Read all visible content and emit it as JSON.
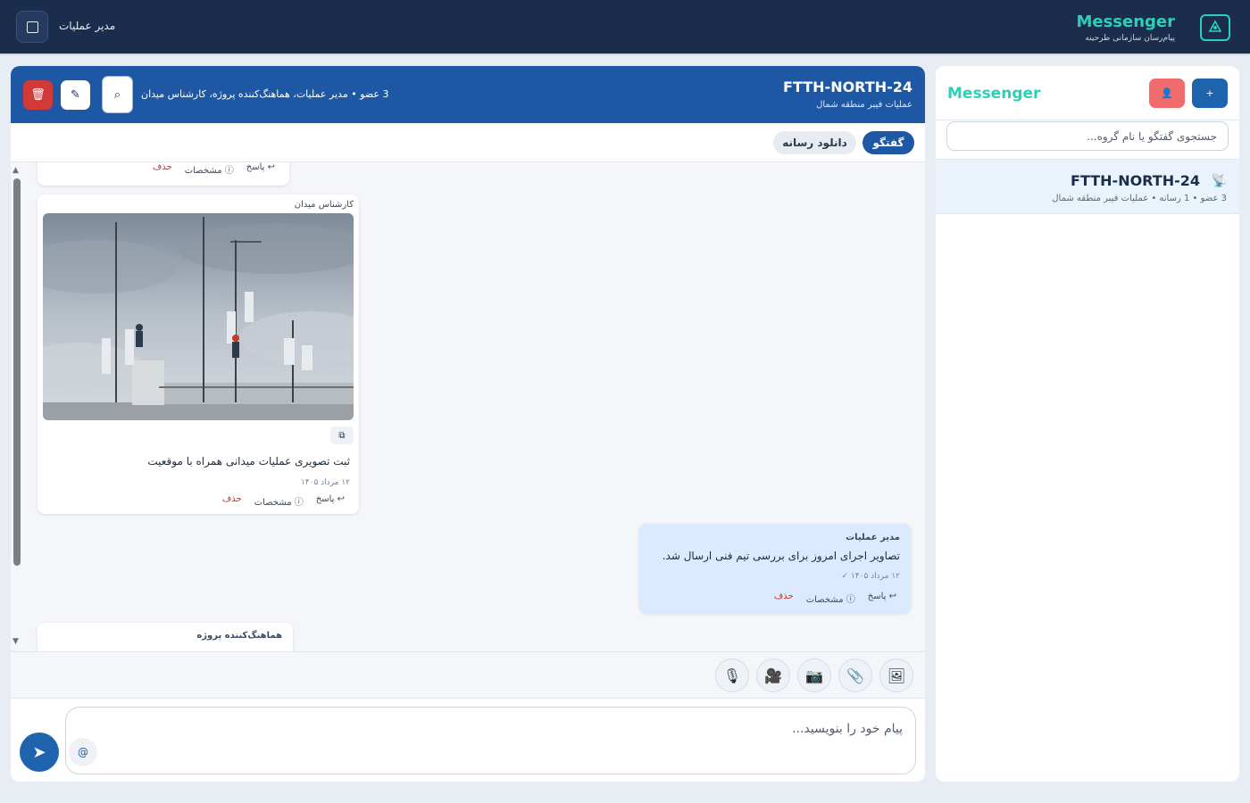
{
  "topbar": {
    "user_name": "مدیر عملیات",
    "brand_title": "Messenger",
    "brand_subtitle": "پیام‌رسان سازمانی طرحینه"
  },
  "sidebar": {
    "title": "Messenger",
    "new_button": "+",
    "search_placeholder": "جستجوی گفتگو یا نام گروه...",
    "conversations": [
      {
        "name": "FTTH-NORTH-24",
        "meta": "3 عضو • 1 رسانه • عملیات فیبر منطقه شمال"
      }
    ]
  },
  "chat": {
    "title": "FTTH-NORTH-24",
    "subtitle": "عملیات فیبر منطقه شمال",
    "members": "3 عضو • مدیر عملیات، هماهنگ‌کننده پروژه، کارشناس میدان",
    "tabs": [
      {
        "label": "گفتگو",
        "active": true
      },
      {
        "label": "دانلود رسانه",
        "active": false
      }
    ],
    "actions": {
      "reply": "↩ پاسخ",
      "info": "ⓘ مشخصات",
      "delete": "حذف"
    },
    "messages": [
      {
        "sender": "کارشناس میدان",
        "text": "ثبت تصویری عملیات میدانی همراه با موقعیت",
        "time": "۱۲ مرداد ۱۴۰۵",
        "has_image": true
      },
      {
        "sender": "مدیر عملیات",
        "text": "تصاویر اجرای امروز برای بررسی تیم فنی ارسال شد.",
        "time": "۱۲ مرداد ۱۴۰۵",
        "own": true
      },
      {
        "sender": "هماهنگ‌کننده پروژه"
      }
    ],
    "attachments": [
      "image-icon",
      "attach-icon",
      "camera-icon",
      "video-icon",
      "mic-icon"
    ],
    "composer_placeholder": "پیام خود را بنویسید...",
    "mention": "@",
    "send": "➤"
  },
  "colors": {
    "topbar": "#1b2d4c",
    "accent": "#2ad1b8",
    "primary": "#1e58a4",
    "danger": "#d23a3a",
    "own_bubble": "#dbeafe"
  }
}
